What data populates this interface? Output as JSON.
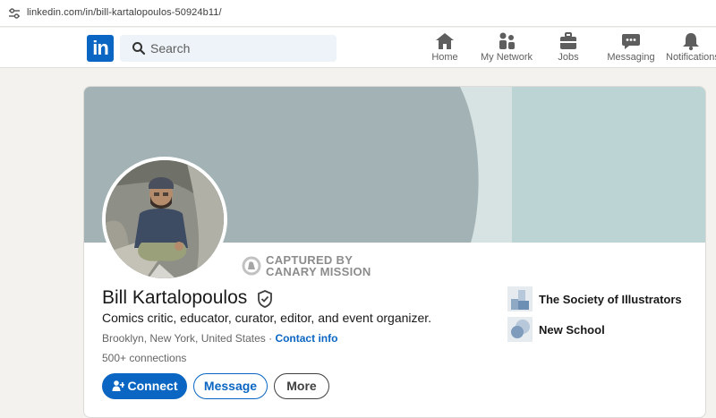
{
  "browser": {
    "url": "linkedin.com/in/bill-kartalopoulos-50924b11/"
  },
  "nav": {
    "logo_text": "in",
    "search_placeholder": "Search",
    "items": [
      {
        "label": "Home",
        "icon": "home-icon"
      },
      {
        "label": "My Network",
        "icon": "network-icon"
      },
      {
        "label": "Jobs",
        "icon": "briefcase-icon"
      },
      {
        "label": "Messaging",
        "icon": "messaging-icon"
      },
      {
        "label": "Notifications",
        "icon": "bell-icon"
      }
    ]
  },
  "stamp": {
    "line1": "CAPTURED BY",
    "line2": "CANARY MISSION"
  },
  "profile": {
    "name": "Bill Kartalopoulos",
    "headline": "Comics critic, educator, curator, editor, and event organizer.",
    "location": "Brooklyn, New York, United States",
    "separator": " · ",
    "contact_info": "Contact info",
    "connections": "500+ connections"
  },
  "actions": {
    "connect": "Connect",
    "message": "Message",
    "more": "More"
  },
  "organizations": [
    {
      "name": "The Society of Illustrators"
    },
    {
      "name": "New School"
    }
  ],
  "colors": {
    "brand": "#0a66c2",
    "banner_gray": "#a2b2b5",
    "banner_light": "#d7e3e3",
    "banner_teal": "#bdd4d5"
  }
}
